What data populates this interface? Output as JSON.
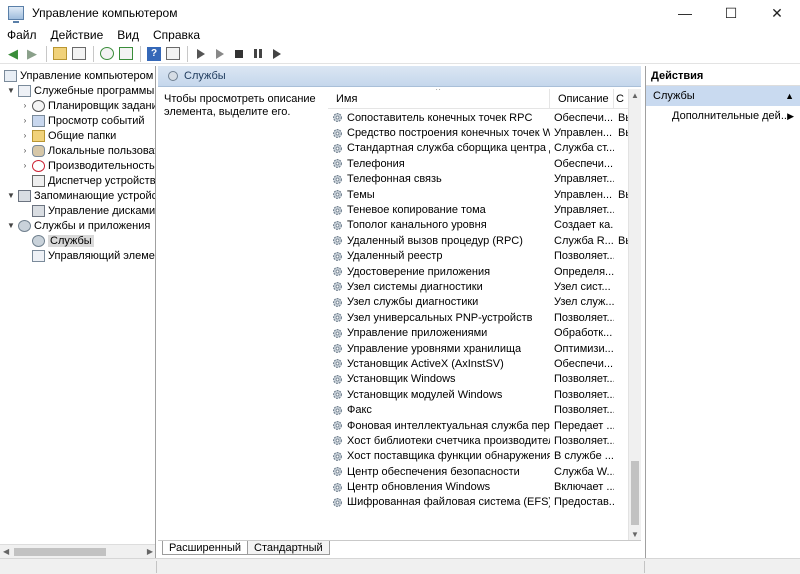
{
  "window": {
    "title": "Управление компьютером",
    "controls": [
      "—",
      "☐",
      "✕"
    ]
  },
  "menu": [
    "Файл",
    "Действие",
    "Вид",
    "Справка"
  ],
  "tree": [
    {
      "label": "Управление компьютером (л",
      "level": 0,
      "icon": "computer-icon",
      "toggle": ""
    },
    {
      "label": "Служебные программы",
      "level": 1,
      "icon": "tools-icon",
      "toggle": "▼"
    },
    {
      "label": "Планировщик заданий",
      "level": 2,
      "icon": "clock-icon",
      "toggle": "›"
    },
    {
      "label": "Просмотр событий",
      "level": 2,
      "icon": "book-icon",
      "toggle": "›"
    },
    {
      "label": "Общие папки",
      "level": 2,
      "icon": "folder-icon",
      "toggle": "›"
    },
    {
      "label": "Локальные пользовате",
      "level": 2,
      "icon": "users-icon",
      "toggle": "›"
    },
    {
      "label": "Производительность",
      "level": 2,
      "icon": "performance-icon",
      "toggle": "›"
    },
    {
      "label": "Диспетчер устройств",
      "level": 2,
      "icon": "device-icon",
      "toggle": ""
    },
    {
      "label": "Запоминающие устройст",
      "level": 1,
      "icon": "storage-icon",
      "toggle": "▼"
    },
    {
      "label": "Управление дисками",
      "level": 2,
      "icon": "disk-icon",
      "toggle": ""
    },
    {
      "label": "Службы и приложения",
      "level": 1,
      "icon": "apps-icon",
      "toggle": "▼"
    },
    {
      "label": "Службы",
      "level": 2,
      "icon": "gear-icon",
      "toggle": "",
      "selected": true
    },
    {
      "label": "Управляющий элемен",
      "level": 2,
      "icon": "control-icon",
      "toggle": ""
    }
  ],
  "services_pane": {
    "title": "Службы",
    "description_hint": "Чтобы просмотреть описание элемента, выделите его.",
    "columns": {
      "name": "Имя",
      "description": "Описание",
      "state": "С"
    },
    "rows": [
      {
        "name": "Сопоставитель конечных точек RPC",
        "desc": "Обеспечи...",
        "state": "Вь"
      },
      {
        "name": "Средство построения конечных точек Windo...",
        "desc": "Управлен...",
        "state": "Вь"
      },
      {
        "name": "Стандартная служба сборщика центра диаг...",
        "desc": "Служба ст...",
        "state": ""
      },
      {
        "name": "Телефония",
        "desc": "Обеспечи...",
        "state": ""
      },
      {
        "name": "Телефонная связь",
        "desc": "Управляет...",
        "state": ""
      },
      {
        "name": "Темы",
        "desc": "Управлен...",
        "state": "Вь"
      },
      {
        "name": "Теневое копирование тома",
        "desc": "Управляет...",
        "state": ""
      },
      {
        "name": "Тополог канального уровня",
        "desc": "Создает ка...",
        "state": ""
      },
      {
        "name": "Удаленный вызов процедур (RPC)",
        "desc": "Служба R...",
        "state": "Вь"
      },
      {
        "name": "Удаленный реестр",
        "desc": "Позволяет...",
        "state": ""
      },
      {
        "name": "Удостоверение приложения",
        "desc": "Определя...",
        "state": ""
      },
      {
        "name": "Узел системы диагностики",
        "desc": "Узел сист...",
        "state": ""
      },
      {
        "name": "Узел службы диагностики",
        "desc": "Узел служ...",
        "state": ""
      },
      {
        "name": "Узел универсальных PNP-устройств",
        "desc": "Позволяет...",
        "state": ""
      },
      {
        "name": "Управление приложениями",
        "desc": "Обработк...",
        "state": ""
      },
      {
        "name": "Управление уровнями хранилища",
        "desc": "Оптимизи...",
        "state": ""
      },
      {
        "name": "Установщик ActiveX (AxInstSV)",
        "desc": "Обеспечи...",
        "state": ""
      },
      {
        "name": "Установщик Windows",
        "desc": "Позволяет...",
        "state": ""
      },
      {
        "name": "Установщик модулей Windows",
        "desc": "Позволяет...",
        "state": ""
      },
      {
        "name": "Факс",
        "desc": "Позволяет...",
        "state": ""
      },
      {
        "name": "Фоновая интеллектуальная служба переда...",
        "desc": "Передает ...",
        "state": ""
      },
      {
        "name": "Хост библиотеки счетчика производитель...",
        "desc": "Позволяет...",
        "state": ""
      },
      {
        "name": "Хост поставщика функции обнаружения",
        "desc": "В службе ...",
        "state": ""
      },
      {
        "name": "Центр обеспечения безопасности",
        "desc": "Служба W...",
        "state": ""
      },
      {
        "name": "Центр обновления Windows",
        "desc": "Включает ...",
        "state": "",
        "highlight": true
      },
      {
        "name": "Шифрованная файловая система (EFS)",
        "desc": "Предостав...",
        "state": ""
      }
    ],
    "tabs": [
      "Расширенный",
      "Стандартный"
    ]
  },
  "actions": {
    "title": "Действия",
    "section": "Службы",
    "item": "Дополнительные дей..."
  },
  "colors": {
    "header_bg": "#c5d7ec",
    "section_bg": "#c9daf0",
    "highlight_underline": "#e01010"
  }
}
